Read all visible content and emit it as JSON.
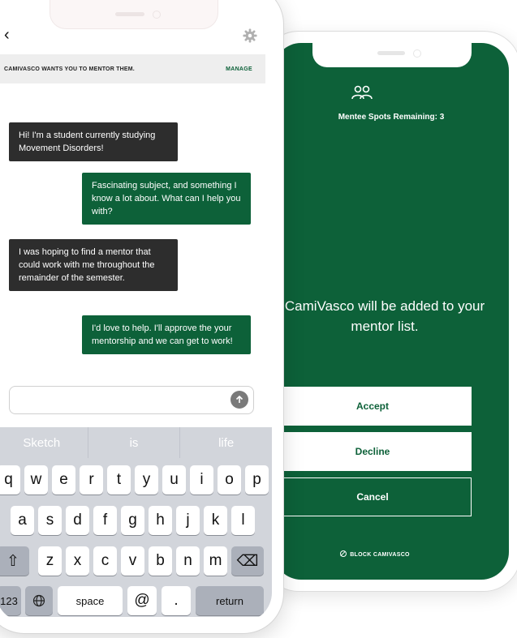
{
  "colors": {
    "brand_green": "#0d6139",
    "bubble_dark": "#2d2d2d",
    "keyboard_bg": "#d2d5db"
  },
  "chat": {
    "banner": {
      "text": "CAMIVASCO WANTS YOU TO MENTOR THEM.",
      "action": "MANAGE"
    },
    "icons": {
      "back": "chevron-left-icon",
      "settings": "gear-icon",
      "send": "arrow-up-icon"
    },
    "messages": [
      {
        "from": "mentee",
        "text": "Hi! I'm a student currently studying Movement Disorders!"
      },
      {
        "from": "mentor",
        "text": "Fascinating subject, and something I know a lot about. What can I help you with?"
      },
      {
        "from": "mentee",
        "text": "I was hoping to find a mentor that could work with me throughout the remainder of the semester."
      },
      {
        "from": "mentor",
        "text": "I'd love to help. I'll approve the your mentorship and we can get to work!"
      }
    ],
    "composer": {
      "value": "",
      "placeholder": ""
    }
  },
  "keyboard": {
    "suggestions": [
      "Sketch",
      "is",
      "life"
    ],
    "row1": [
      "q",
      "w",
      "e",
      "r",
      "t",
      "y",
      "u",
      "i",
      "o",
      "p"
    ],
    "row2": [
      "a",
      "s",
      "d",
      "f",
      "g",
      "h",
      "j",
      "k",
      "l"
    ],
    "row3": [
      "z",
      "x",
      "c",
      "v",
      "b",
      "n",
      "m"
    ],
    "shift": "⇧",
    "delete": "⌫",
    "numbers": "123",
    "globe": "globe-icon",
    "space": "space",
    "at": "@",
    "period": ".",
    "return": "return"
  },
  "request": {
    "icon": "mentee-group-icon",
    "spots": "Mentee Spots Remaining: 3",
    "message": "CamiVasco will be added to your mentor list.",
    "accept": "Accept",
    "decline": "Decline",
    "cancel": "Cancel",
    "block": "BLOCK CAMIVASCO"
  }
}
